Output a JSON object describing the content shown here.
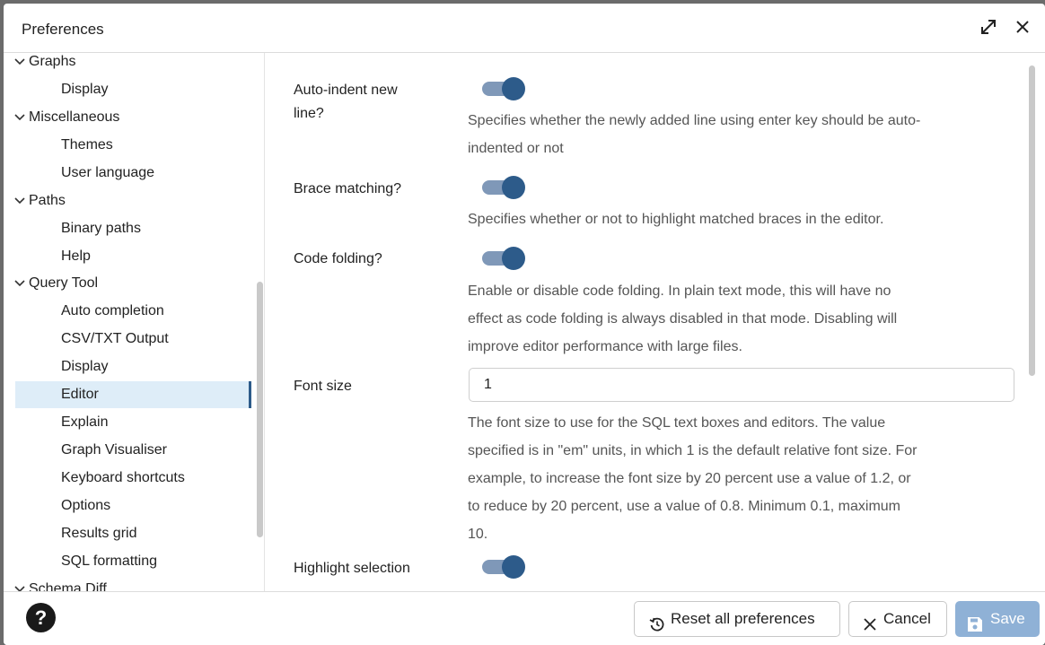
{
  "title": "Preferences",
  "titlebar": {
    "maximize_icon": "expand-diagonal-icon",
    "close_icon": "close-icon"
  },
  "sidebar": {
    "items": [
      {
        "label": "Graphs",
        "kind": "group"
      },
      {
        "label": "Display",
        "kind": "child"
      },
      {
        "label": "Miscellaneous",
        "kind": "group"
      },
      {
        "label": "Themes",
        "kind": "child"
      },
      {
        "label": "User language",
        "kind": "child"
      },
      {
        "label": "Paths",
        "kind": "group"
      },
      {
        "label": "Binary paths",
        "kind": "child"
      },
      {
        "label": "Help",
        "kind": "child"
      },
      {
        "label": "Query Tool",
        "kind": "group"
      },
      {
        "label": "Auto completion",
        "kind": "child"
      },
      {
        "label": "CSV/TXT Output",
        "kind": "child"
      },
      {
        "label": "Display",
        "kind": "child"
      },
      {
        "label": "Editor",
        "kind": "child",
        "selected": true
      },
      {
        "label": "Explain",
        "kind": "child"
      },
      {
        "label": "Graph Visualiser",
        "kind": "child"
      },
      {
        "label": "Keyboard shortcuts",
        "kind": "child"
      },
      {
        "label": "Options",
        "kind": "child"
      },
      {
        "label": "Results grid",
        "kind": "child"
      },
      {
        "label": "SQL formatting",
        "kind": "child"
      },
      {
        "label": "Schema Diff",
        "kind": "group"
      }
    ]
  },
  "content": {
    "auto_indent": {
      "label_line1": "Auto-indent new",
      "label_line2": "line?",
      "enabled": true,
      "desc_line1": "Specifies whether the newly added line using enter key should be auto-",
      "desc_line2": "indented or not"
    },
    "brace_matching": {
      "label": "Brace matching?",
      "enabled": true,
      "desc": "Specifies whether or not to highlight matched braces in the editor."
    },
    "code_folding": {
      "label": "Code folding?",
      "enabled": true,
      "desc_line1": "Enable or disable code folding. In plain text mode, this will have no",
      "desc_line2": "effect as code folding is always disabled in that mode. Disabling will",
      "desc_line3": "improve editor performance with large files."
    },
    "font_size": {
      "label": "Font size",
      "value": "1",
      "desc_line1": "The font size to use for the SQL text boxes and editors. The value",
      "desc_line2": "specified is in \"em\" units, in which 1 is the default relative font size. For",
      "desc_line3": "example, to increase the font size by 20 percent use a value of 1.2, or",
      "desc_line4": "to reduce by 20 percent, use a value of 0.8. Minimum 0.1, maximum",
      "desc_line5": "10."
    },
    "highlight_selection": {
      "label": "Highlight selection",
      "enabled": true
    }
  },
  "footer": {
    "help_label": "?",
    "reset_label": "Reset all preferences",
    "cancel_label": "Cancel",
    "save_label": "Save"
  },
  "colors": {
    "accent": "#2d5b8a",
    "selected_bg": "#deedf8",
    "save_disabled": "#8fb1d6"
  }
}
